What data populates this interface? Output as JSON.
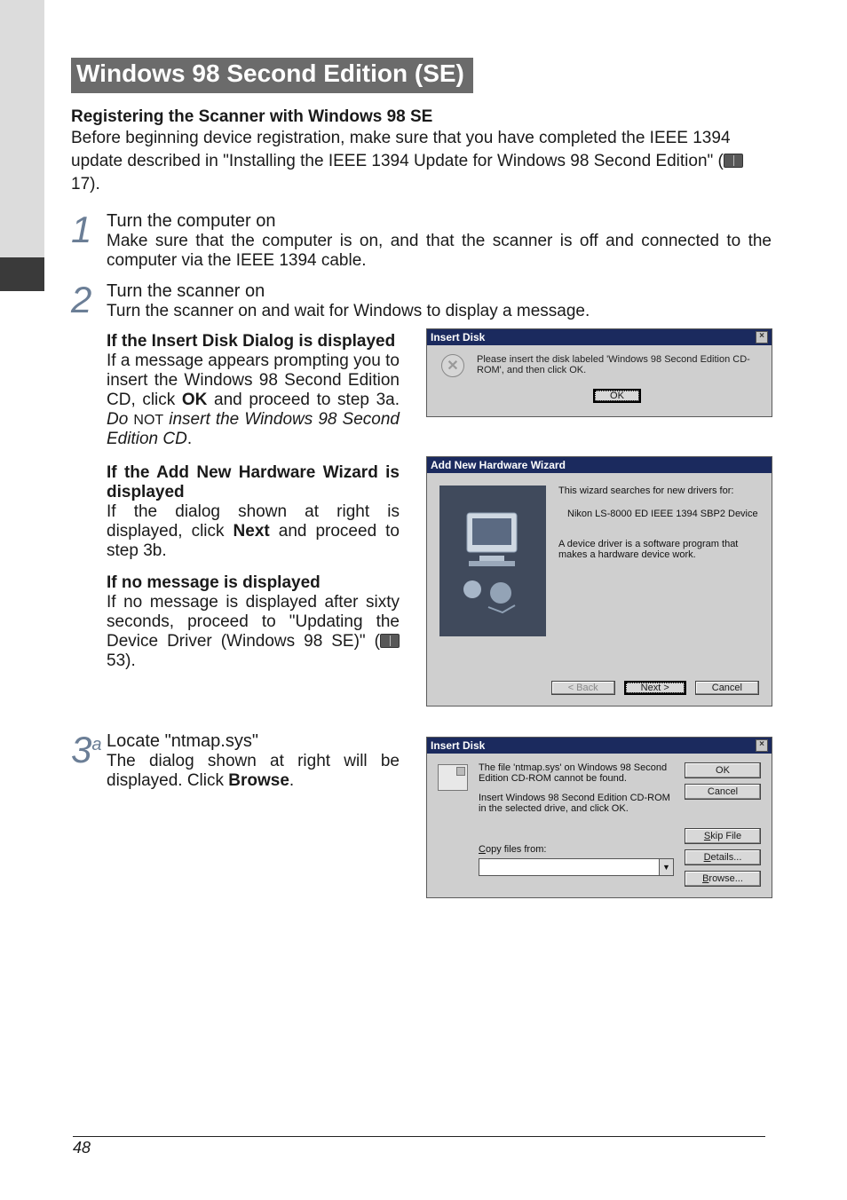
{
  "page_number": "48",
  "section_title": "Windows 98 Second Edition (SE)",
  "subtitle": "Registering the Scanner with Windows 98 SE",
  "intro_a": "Before beginning device registration, make sure that you have completed the IEEE 1394 update described in \"Installing the IEEE 1394 Update for Windows 98 Second Edition\" (",
  "intro_b": " 17).",
  "step1": {
    "num": "1",
    "head": "Turn the computer on",
    "body": "Make sure that the computer is on, and that the scanner is off and connected to the computer via the IEEE 1394 cable."
  },
  "step2": {
    "num": "2",
    "head": "Turn the scanner on",
    "body": "Turn the scanner on and wait for Windows to display a message.",
    "sub_a_head": "If the Insert Disk Dialog is displayed",
    "sub_a_body_1": "If a message appears prompting you to insert the Windows 98 Second Edition CD, click ",
    "sub_a_body_bold": "OK",
    "sub_a_body_2": " and proceed to step 3a.  ",
    "sub_a_body_ital1": "Do ",
    "sub_a_body_sc": "NOT",
    "sub_a_body_ital2": " insert the Windows 98 Second Edition CD",
    "sub_a_body_3": ".",
    "sub_b_head": "If the Add New Hardware Wizard is displayed",
    "sub_b_body_1": "If the dialog shown at right is displayed, click ",
    "sub_b_body_bold": "Next",
    "sub_b_body_2": " and proceed to step 3b.",
    "sub_c_head": "If no message is displayed",
    "sub_c_body_1": "If no message is displayed after sixty seconds, proceed to \"Updating the Device Driver (Windows 98 SE)\" (",
    "sub_c_body_2": " 53)."
  },
  "step3a": {
    "num": "3",
    "sup": "a",
    "head": "Locate \"ntmap.sys\"",
    "body_1": "The dialog shown at right will be displayed.  Click ",
    "body_bold": "Browse",
    "body_2": "."
  },
  "dlg1": {
    "title": "Insert Disk",
    "text": "Please insert the disk labeled 'Windows 98 Second Edition CD-ROM', and then click OK.",
    "ok": "OK"
  },
  "dlg2": {
    "title": "Add New Hardware Wizard",
    "line1": "This wizard searches for new drivers for:",
    "line2": "Nikon   LS-8000 ED        IEEE 1394 SBP2 Device",
    "line3": "A device driver is a software program that makes a hardware device work.",
    "back": "< Back",
    "next": "Next >",
    "cancel": "Cancel"
  },
  "dlg3": {
    "title": "Insert Disk",
    "msg1": "The file 'ntmap.sys' on Windows 98 Second Edition CD-ROM cannot be found.",
    "msg2": "Insert Windows 98 Second Edition CD-ROM in the selected drive, and click OK.",
    "copy_label": "Copy files from:",
    "ok": "OK",
    "cancel": "Cancel",
    "skip": "Skip File",
    "details": "Details...",
    "browse": "Browse...",
    "combo_value": ""
  }
}
